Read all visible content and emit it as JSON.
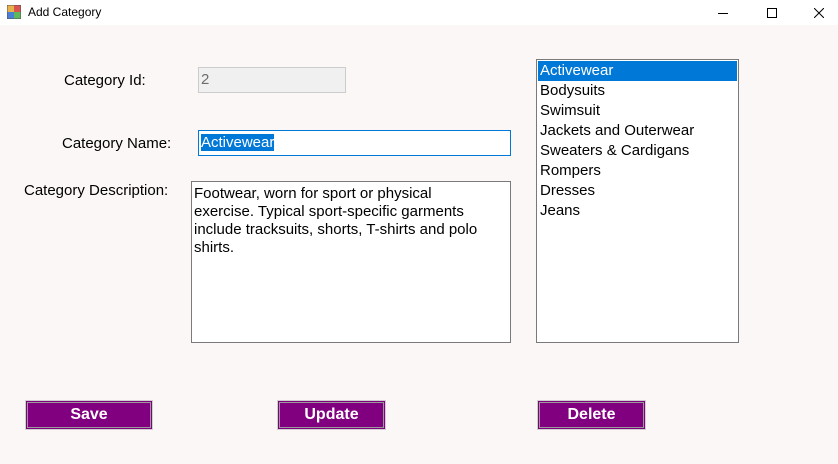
{
  "window": {
    "title": "Add Category",
    "controls": {
      "minimize_icon": "minimize-icon",
      "maximize_icon": "maximize-icon",
      "close_icon": "close-icon"
    }
  },
  "form": {
    "category_id": {
      "label": "Category Id:",
      "value": "2",
      "enabled": false
    },
    "category_name": {
      "label": "Category Name:",
      "value": "Activewear",
      "text_selected": true
    },
    "category_description": {
      "label": "Category Description:",
      "value": "Footwear, worn for sport or physical exercise. Typical sport-specific garments include tracksuits, shorts, T-shirts and polo shirts."
    }
  },
  "category_list": {
    "items": [
      "Activewear",
      "Bodysuits",
      "Swimsuit",
      "Jackets and Outerwear",
      "Sweaters & Cardigans",
      "Rompers",
      "Dresses",
      "Jeans"
    ],
    "selected_index": 0
  },
  "buttons": {
    "save": "Save",
    "update": "Update",
    "delete": "Delete"
  },
  "colors": {
    "button_bg": "#800080",
    "button_text": "#ffffff",
    "selection": "#0078d7",
    "client_bg": "#fcf7f7"
  }
}
